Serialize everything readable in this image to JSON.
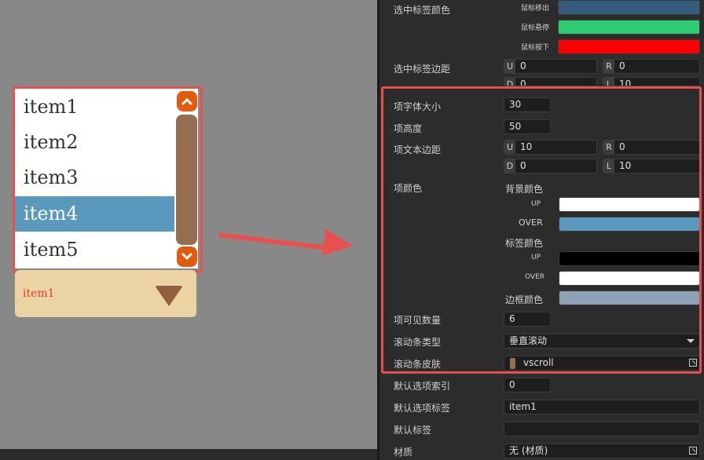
{
  "preview": {
    "list_items": [
      "item1",
      "item2",
      "item3",
      "item4",
      "item5"
    ],
    "selected_item": "item4",
    "combo_label": "item1"
  },
  "inspector": {
    "selected_label_color": {
      "label": "选中标签颜色",
      "out_label": "鼠标移出",
      "hover_label": "鼠标悬停",
      "down_label": "鼠标按下",
      "out_color": "#355c7a",
      "hover_color": "#2ecc71",
      "down_color": "#ff0000"
    },
    "selected_label_padding": {
      "label": "选中标签边距",
      "u_prefix": "U",
      "u_value": "0",
      "r_prefix": "R",
      "r_value": "0",
      "d_prefix": "D",
      "d_value": "0",
      "l_prefix": "L",
      "l_value": "10"
    },
    "item_font_size": {
      "label": "项字体大小",
      "value": "30"
    },
    "item_height": {
      "label": "项高度",
      "value": "50"
    },
    "item_text_padding": {
      "label": "项文本边距",
      "u_prefix": "U",
      "u_value": "10",
      "r_prefix": "R",
      "r_value": "0",
      "d_prefix": "D",
      "d_value": "0",
      "l_prefix": "L",
      "l_value": "10"
    },
    "item_color": {
      "label": "项颜色",
      "bg_label": "背景颜色",
      "bg_up_label": "UP",
      "bg_over_label": "OVER",
      "bg_up_color": "#ffffff",
      "bg_over_color": "#5b98bd",
      "tag_label": "标签颜色",
      "tag_up_label": "UP",
      "tag_over_label": "OVER",
      "tag_up_color": "#000000",
      "tag_over_color": "#ffffff",
      "border_label": "边框颜色",
      "border_color": "#8da3b5"
    },
    "visible_count": {
      "label": "项可见数量",
      "value": "6"
    },
    "scrollbar_type": {
      "label": "滚动条类型",
      "value": "垂直滚动"
    },
    "scrollbar_skin": {
      "label": "滚动条皮肤",
      "value": "vscroll"
    },
    "default_index": {
      "label": "默认选项索引",
      "value": "0"
    },
    "default_label": {
      "label": "默认选项标签",
      "value": "item1"
    },
    "default_tag": {
      "label": "默认标签",
      "value": ""
    },
    "material": {
      "label": "材质",
      "value": "无 (材质)"
    }
  },
  "colors": {
    "highlight": "#e85050",
    "scroll_button": "#e25b0e",
    "scroll_thumb": "#956e52",
    "combo_bg": "#ebd3a3",
    "selected_row": "#5b98bd"
  }
}
